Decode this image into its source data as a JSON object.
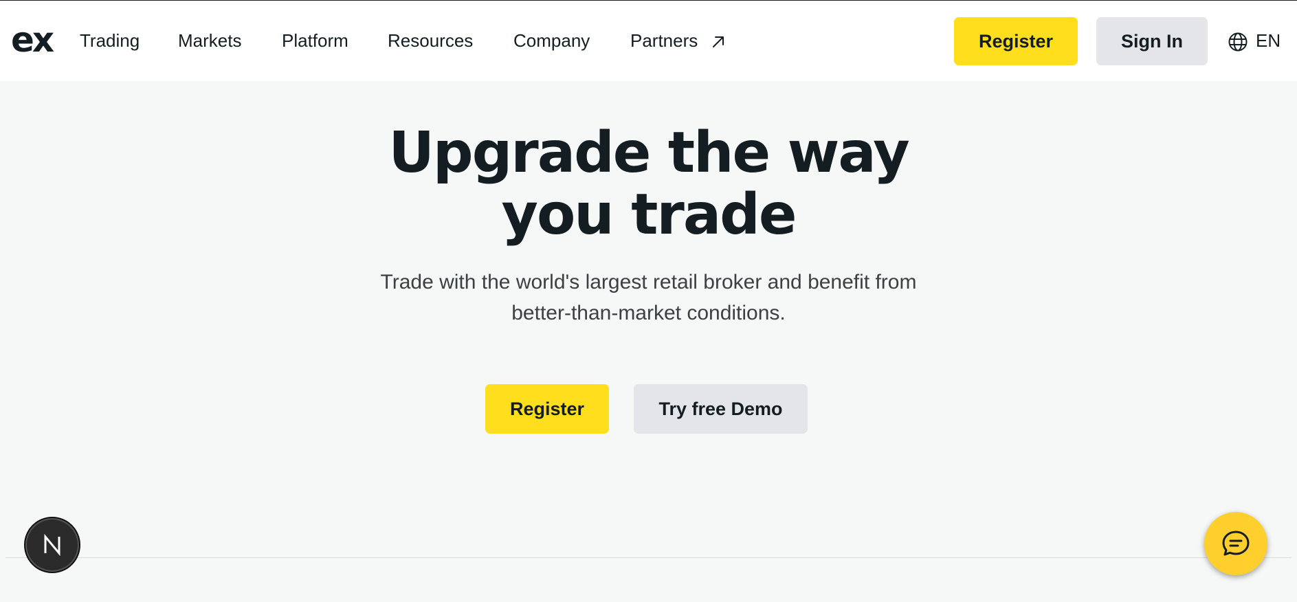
{
  "brand": {
    "logo_text": "ex"
  },
  "nav": {
    "items": [
      {
        "label": "Trading"
      },
      {
        "label": "Markets"
      },
      {
        "label": "Platform"
      },
      {
        "label": "Resources"
      },
      {
        "label": "Company"
      },
      {
        "label": "Partners"
      }
    ]
  },
  "header_actions": {
    "register_label": "Register",
    "signin_label": "Sign In",
    "language": "EN"
  },
  "hero": {
    "title_line1": "Upgrade the way",
    "title_line2": "you trade",
    "subtitle_line1": "Trade with the world's largest retail broker and benefit from",
    "subtitle_line2": "better-than-market conditions.",
    "register_label": "Register",
    "demo_label": "Try free Demo"
  },
  "widgets": {
    "badge_letter": "N",
    "chat_icon": "chat-bubble-icon"
  },
  "colors": {
    "accent_yellow": "#ffde1e",
    "secondary_gray": "#e3e5e8",
    "text_dark": "#141d22",
    "page_bg": "#f6f7f7"
  }
}
